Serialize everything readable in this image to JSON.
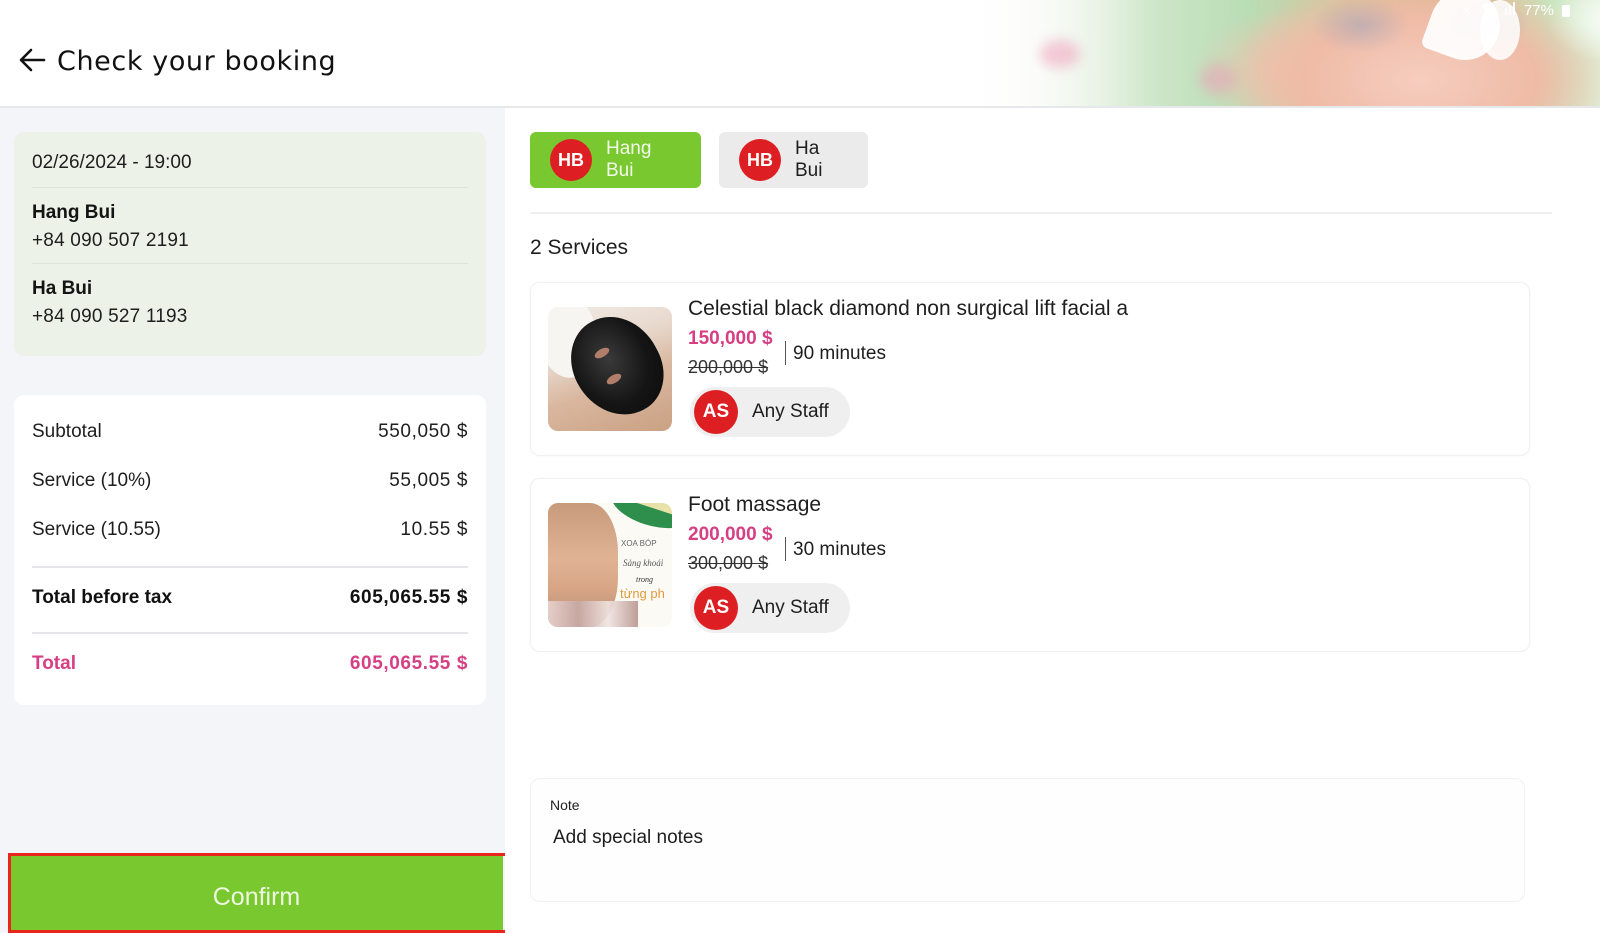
{
  "status_bar": {
    "battery": "77%"
  },
  "header": {
    "title": "Check your booking",
    "back_icon": "arrow-left-icon"
  },
  "booking": {
    "datetime": "02/26/2024 - 19:00",
    "guests": [
      {
        "name": "Hang Bui",
        "phone": "+84 090 507 2191"
      },
      {
        "name": "Ha Bui",
        "phone": "+84 090 527 1193"
      }
    ]
  },
  "summary": {
    "rows": [
      {
        "label": "Subtotal",
        "value": "550,050 $"
      },
      {
        "label": "Service (10%)",
        "value": "55,005 $"
      },
      {
        "label": "Service (10.55)",
        "value": "10.55 $"
      }
    ],
    "total_before_tax": {
      "label": "Total before tax",
      "value": "605,065.55 $"
    },
    "total": {
      "label": "Total",
      "value": "605,065.55 $"
    }
  },
  "confirm_label": "Confirm",
  "guest_tabs": [
    {
      "initials": "HB",
      "name": "Hang Bui",
      "active": true
    },
    {
      "initials": "HB",
      "name": "Ha Bui",
      "active": false
    }
  ],
  "services_count": "2 Services",
  "services": [
    {
      "title": "Celestial black diamond non surgical lift facial a",
      "price": "150,000 $",
      "old_price": "200,000 $",
      "duration": "90 minutes",
      "staff": {
        "initials": "AS",
        "name": "Any Staff"
      },
      "thumb": "facial-mask-photo"
    },
    {
      "title": "Foot massage",
      "price": "200,000 $",
      "old_price": "300,000 $",
      "duration": "30 minutes",
      "staff": {
        "initials": "AS",
        "name": "Any Staff"
      },
      "thumb": "massage-photo",
      "thumb_text": [
        "XOA BÓP",
        "Sảng khoái",
        "trong",
        "từng ph"
      ]
    }
  ],
  "note": {
    "label": "Note",
    "placeholder": "Add special notes",
    "value": ""
  },
  "colors": {
    "accent_green": "#79c830",
    "price_pink": "#d63f83",
    "avatar_red": "#dd1f23",
    "highlight_red": "#e8261c"
  }
}
